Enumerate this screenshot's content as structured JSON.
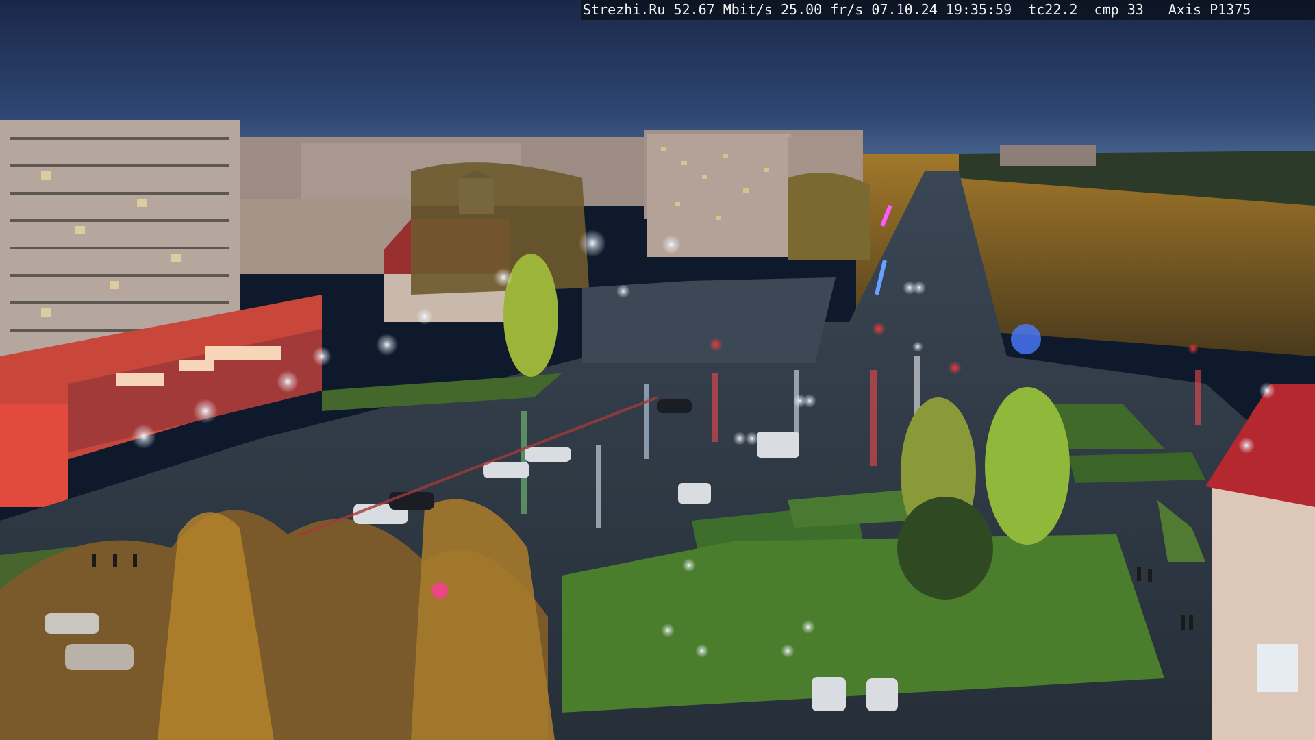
{
  "camera_overlay": {
    "text": "Strezhi.Ru 52.67 Mbit/s 25.00 fr/s 07.10.24 19:35:59  tc22.2  cmp 33   Axis P1375"
  },
  "scene": {
    "description_colors": {
      "sky_top": "#1c2a4a",
      "sky_horizon": "#3d5a86",
      "asphalt": "#2f3a45",
      "lawn": "#3f6a2a",
      "autumn_foliage": "#b98a2c",
      "building_panel": "#b9aaa0",
      "storefront_red": "#c8483c"
    }
  }
}
